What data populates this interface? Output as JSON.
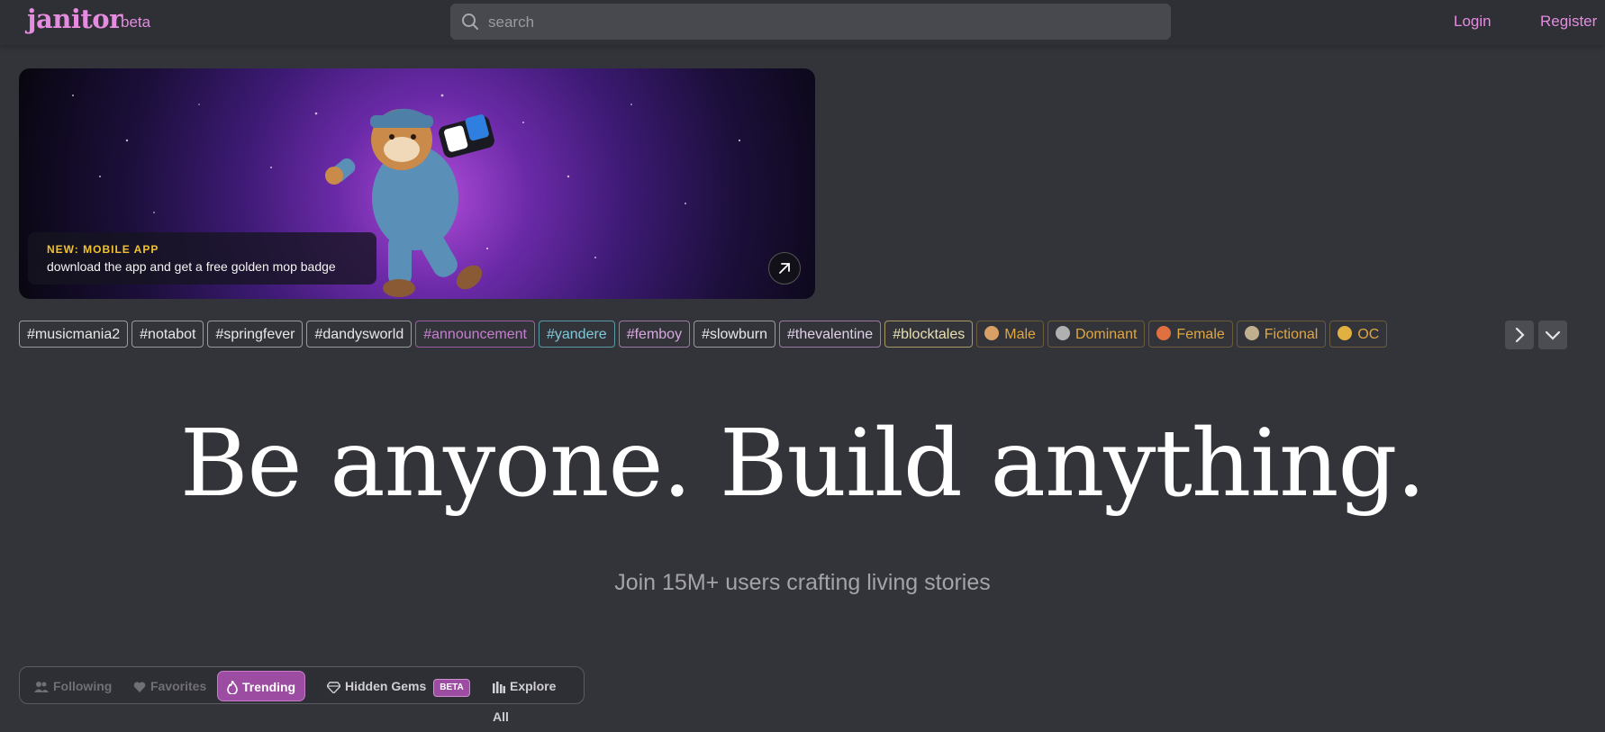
{
  "header": {
    "logo": "janitor",
    "logo_badge": "beta",
    "search_placeholder": "search",
    "login": "Login",
    "register": "Register"
  },
  "banner": {
    "tag": "NEW: MOBILE APP",
    "text": "download the app and get a free golden mop badge"
  },
  "tags": [
    {
      "label": "#musicmania2",
      "color": "#e8e8e8",
      "border": "#9a9aa0"
    },
    {
      "label": "#notabot",
      "color": "#e8e8e8",
      "border": "#9a9aa0"
    },
    {
      "label": "#springfever",
      "color": "#e8e8e8",
      "border": "#9a9aa0"
    },
    {
      "label": "#dandysworld",
      "color": "#e8e8e8",
      "border": "#9a9aa0"
    },
    {
      "label": "#announcement",
      "color": "#c67fd0",
      "border": "#9a5ea3"
    },
    {
      "label": "#yandere",
      "color": "#7fc8d8",
      "border": "#5a9aa8"
    },
    {
      "label": "#femboy",
      "color": "#d8a8e0",
      "border": "#9a7aa3"
    },
    {
      "label": "#slowburn",
      "color": "#e8e8e8",
      "border": "#9a9aa0"
    },
    {
      "label": "#thevalentine",
      "color": "#e0d0e8",
      "border": "#9a7aa3"
    },
    {
      "label": "#blocktales",
      "color": "#e8e0b0",
      "border": "#a89a60"
    },
    {
      "label": "Male",
      "color": "#e0a640",
      "border": "#6a5a3a",
      "emoji": "#d9a066"
    },
    {
      "label": "Dominant",
      "color": "#e0a640",
      "border": "#6a5a3a",
      "emoji": "#b0b0b0"
    },
    {
      "label": "Female",
      "color": "#e0a640",
      "border": "#6a5a3a",
      "emoji": "#e07040"
    },
    {
      "label": "Fictional",
      "color": "#e0a640",
      "border": "#6a5a3a",
      "emoji": "#c0b090"
    },
    {
      "label": "OC",
      "color": "#e0a640",
      "border": "#6a5a3a",
      "emoji": "#e0b040"
    }
  ],
  "hero": {
    "title": "Be anyone. Build anything.",
    "subtitle": "Join 15M+ users crafting living stories"
  },
  "tabs": {
    "following": "Following",
    "favorites": "Favorites",
    "trending": "Trending",
    "hidden_gems": "Hidden Gems",
    "hidden_gems_badge": "BETA",
    "explore_all": "Explore All"
  },
  "colors": {
    "accent": "#e58be0",
    "background": "#33343a",
    "trending_bg": "#9d4da1"
  }
}
